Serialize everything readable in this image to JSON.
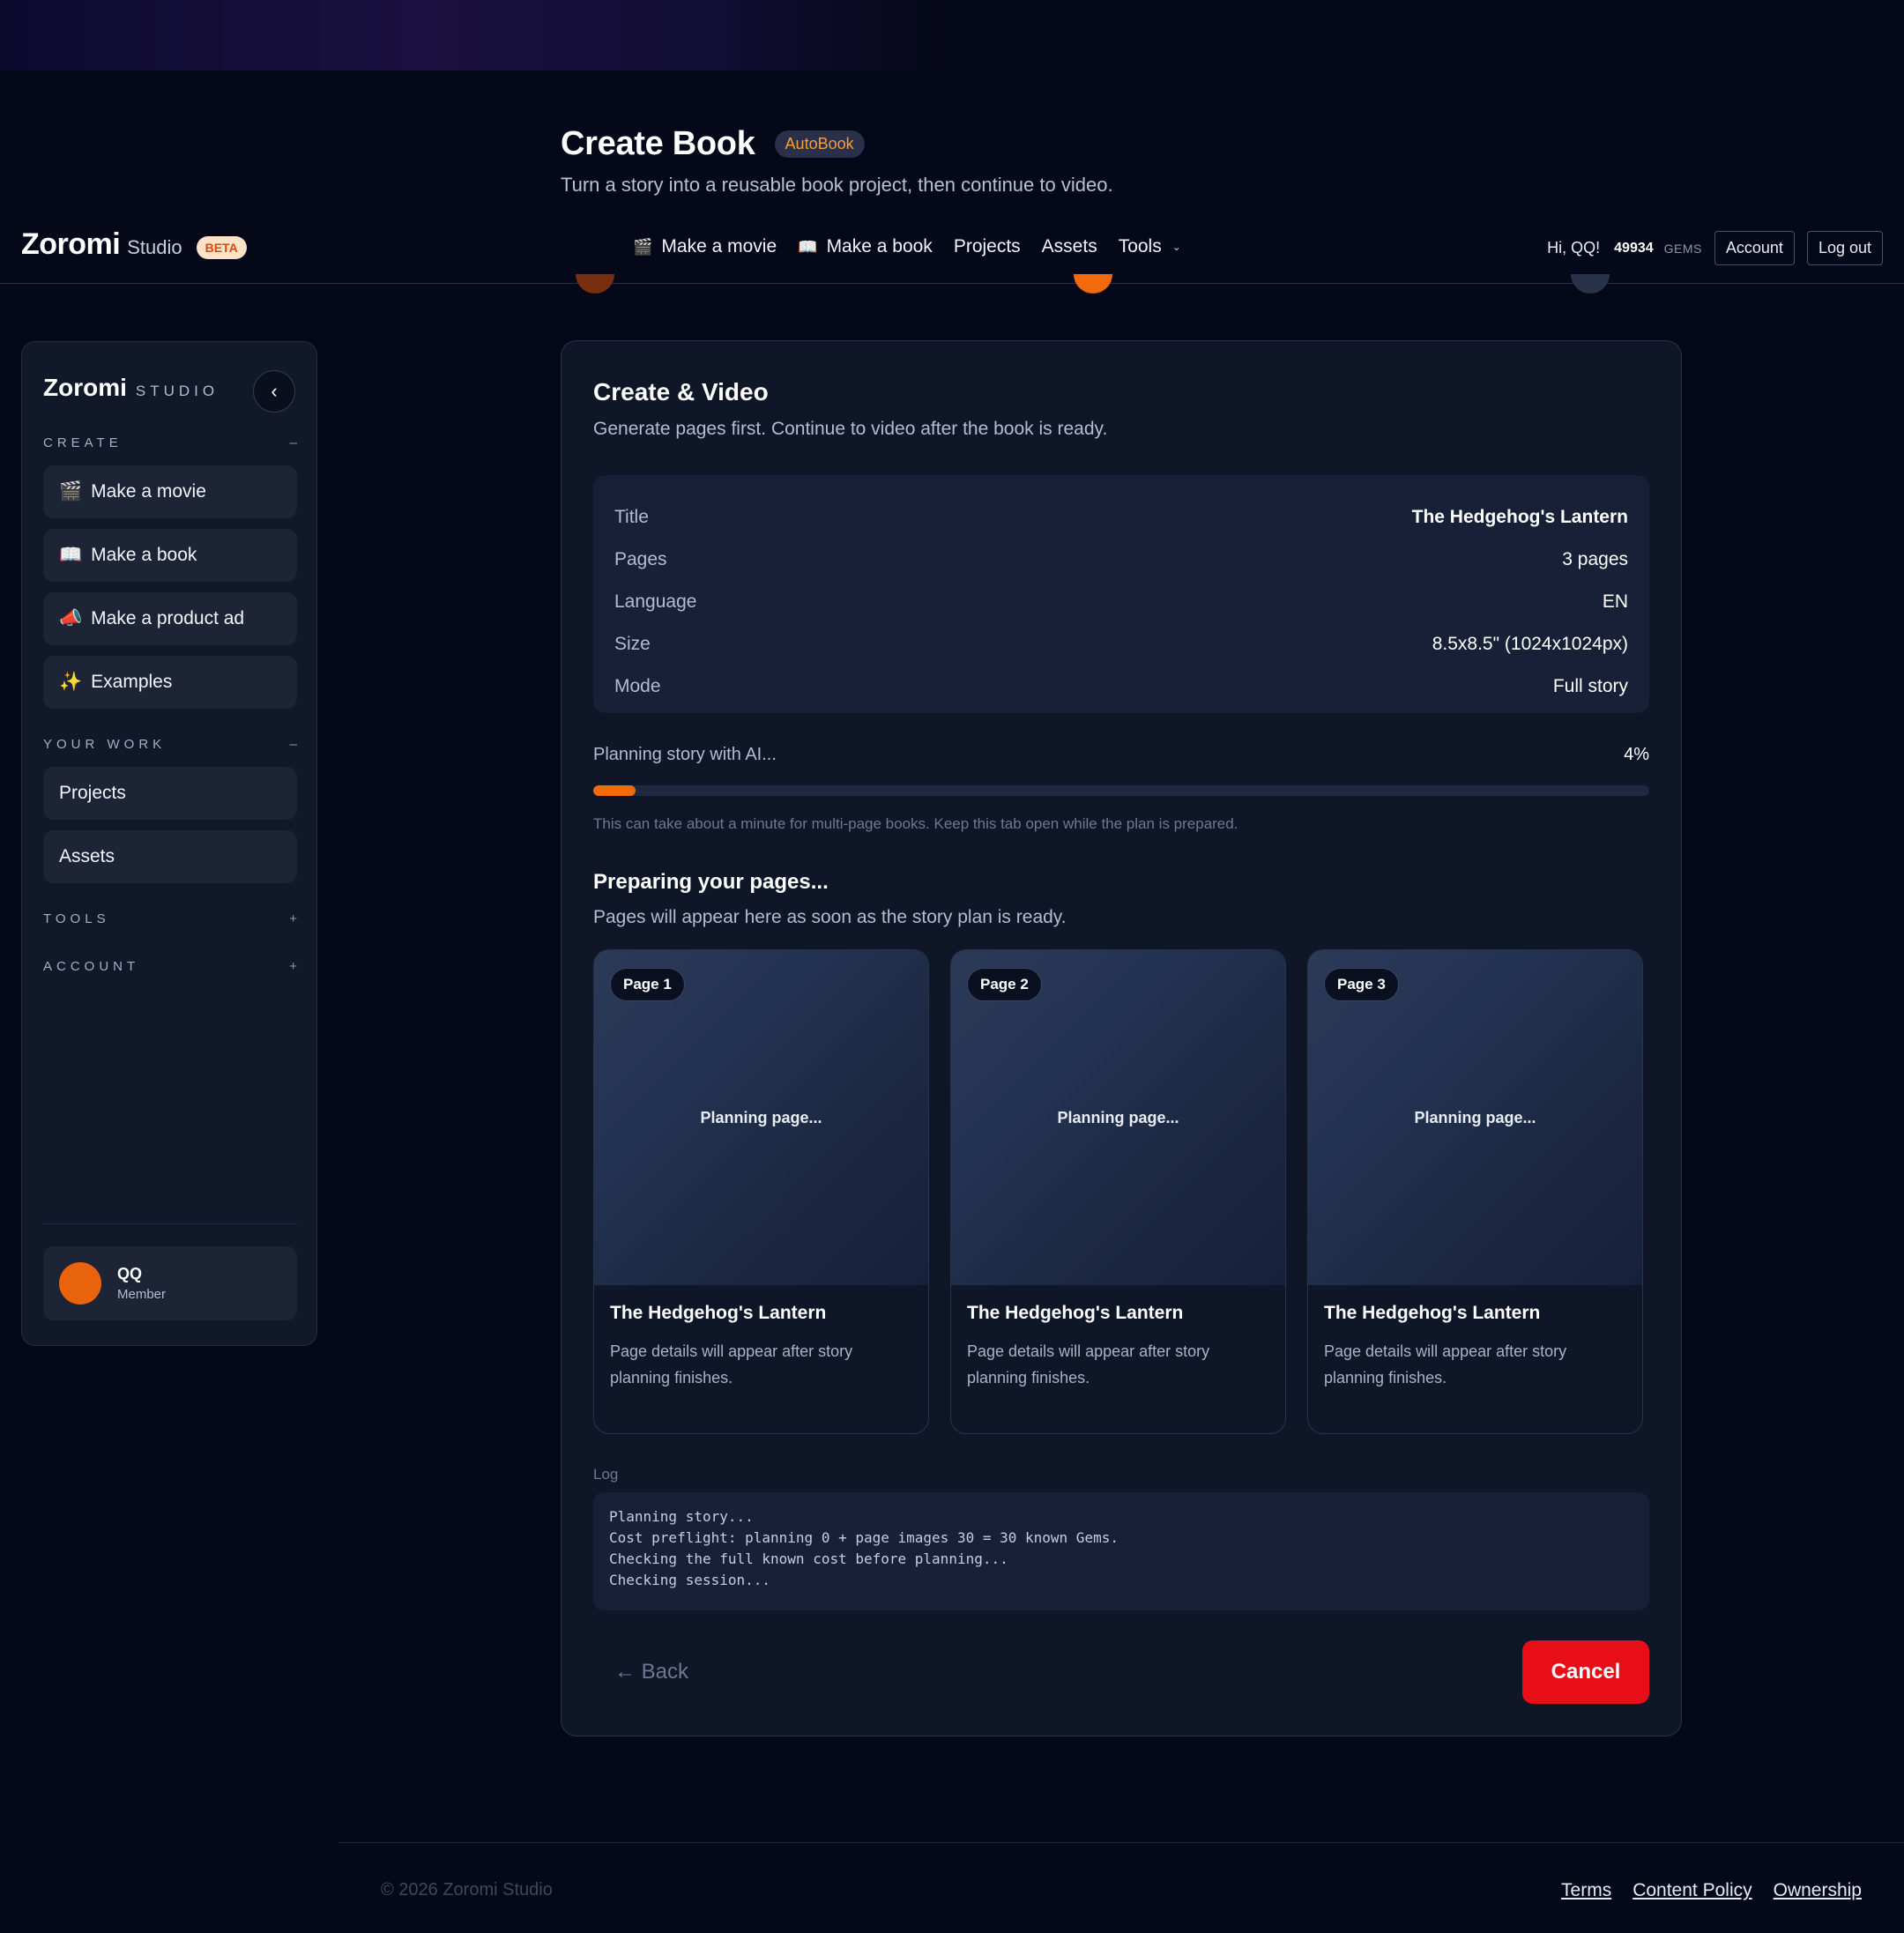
{
  "page": {
    "title": "Create Book",
    "badge": "AutoBook",
    "subtitle": "Turn a story into a reusable book project, then continue to video."
  },
  "topbar": {
    "brand": "Zoromi",
    "brand_suffix": "Studio",
    "beta": "BETA",
    "nav": [
      {
        "label": "Make a movie",
        "icon": "clapper-icon",
        "glyph": "🎬"
      },
      {
        "label": "Make a book",
        "icon": "book-icon",
        "glyph": "📖"
      },
      {
        "label": "Projects"
      },
      {
        "label": "Assets"
      },
      {
        "label": "Tools",
        "chevron": "⌄"
      }
    ],
    "greeting": "Hi, QQ!",
    "gems_count": "49934",
    "gems_label": "GEMS",
    "account_label": "Account",
    "logout_label": "Log out"
  },
  "sidebar": {
    "brand": "Zoromi",
    "brand_suffix": "STUDIO",
    "collapse_glyph": "‹",
    "sections": {
      "create": {
        "label": "CREATE",
        "toggle": "–"
      },
      "your_work": {
        "label": "YOUR WORK",
        "toggle": "–"
      },
      "tools": {
        "label": "TOOLS",
        "toggle": "+"
      },
      "account": {
        "label": "ACCOUNT",
        "toggle": "+"
      }
    },
    "create_items": [
      {
        "label": "Make a movie",
        "icon": "clapper-icon",
        "glyph": "🎬"
      },
      {
        "label": "Make a book",
        "icon": "book-icon",
        "glyph": "📖"
      },
      {
        "label": "Make a product ad",
        "icon": "megaphone-icon",
        "glyph": "📣"
      },
      {
        "label": "Examples",
        "icon": "sparkles-icon",
        "glyph": "✨"
      }
    ],
    "work_items": [
      {
        "label": "Projects"
      },
      {
        "label": "Assets"
      }
    ],
    "user": {
      "name": "QQ",
      "role": "Member"
    }
  },
  "main": {
    "title": "Create & Video",
    "subtitle": "Generate pages first. Continue to video after the book is ready.",
    "summary": [
      {
        "label": "Title",
        "value": "The Hedgehog's Lantern"
      },
      {
        "label": "Pages",
        "value": "3 pages"
      },
      {
        "label": "Language",
        "value": "EN"
      },
      {
        "label": "Size",
        "value": "8.5x8.5\" (1024x1024px)"
      },
      {
        "label": "Mode",
        "value": "Full story"
      }
    ],
    "progress": {
      "label": "Planning story with AI...",
      "percent_text": "4%",
      "percent": 4,
      "note": "This can take about a minute for multi-page books. Keep this tab open while the plan is prepared."
    },
    "preparing": {
      "title": "Preparing your pages...",
      "subtitle": "Pages will appear here as soon as the story plan is ready."
    },
    "pages": [
      {
        "pill": "Page 1",
        "status": "Planning page...",
        "name": "The Hedgehog's Lantern",
        "desc": "Page details will appear after story planning finishes."
      },
      {
        "pill": "Page 2",
        "status": "Planning page...",
        "name": "The Hedgehog's Lantern",
        "desc": "Page details will appear after story planning finishes."
      },
      {
        "pill": "Page 3",
        "status": "Planning page...",
        "name": "The Hedgehog's Lantern",
        "desc": "Page details will appear after story planning finishes."
      }
    ],
    "log_label": "Log",
    "log_text": "Planning story...\nCost preflight: planning 0 + page images 30 = 30 known Gems.\nChecking the full known cost before planning...\nChecking session...",
    "back_label": "← Back",
    "cancel_label": "Cancel"
  },
  "footer": {
    "copyright": "© 2026 Zoromi Studio",
    "links": [
      "Terms",
      "Content Policy",
      "Ownership"
    ]
  },
  "colors": {
    "background": "#050818",
    "accent": "#f26a0c",
    "cancel": "#e80e17",
    "card": "#0f1628"
  }
}
